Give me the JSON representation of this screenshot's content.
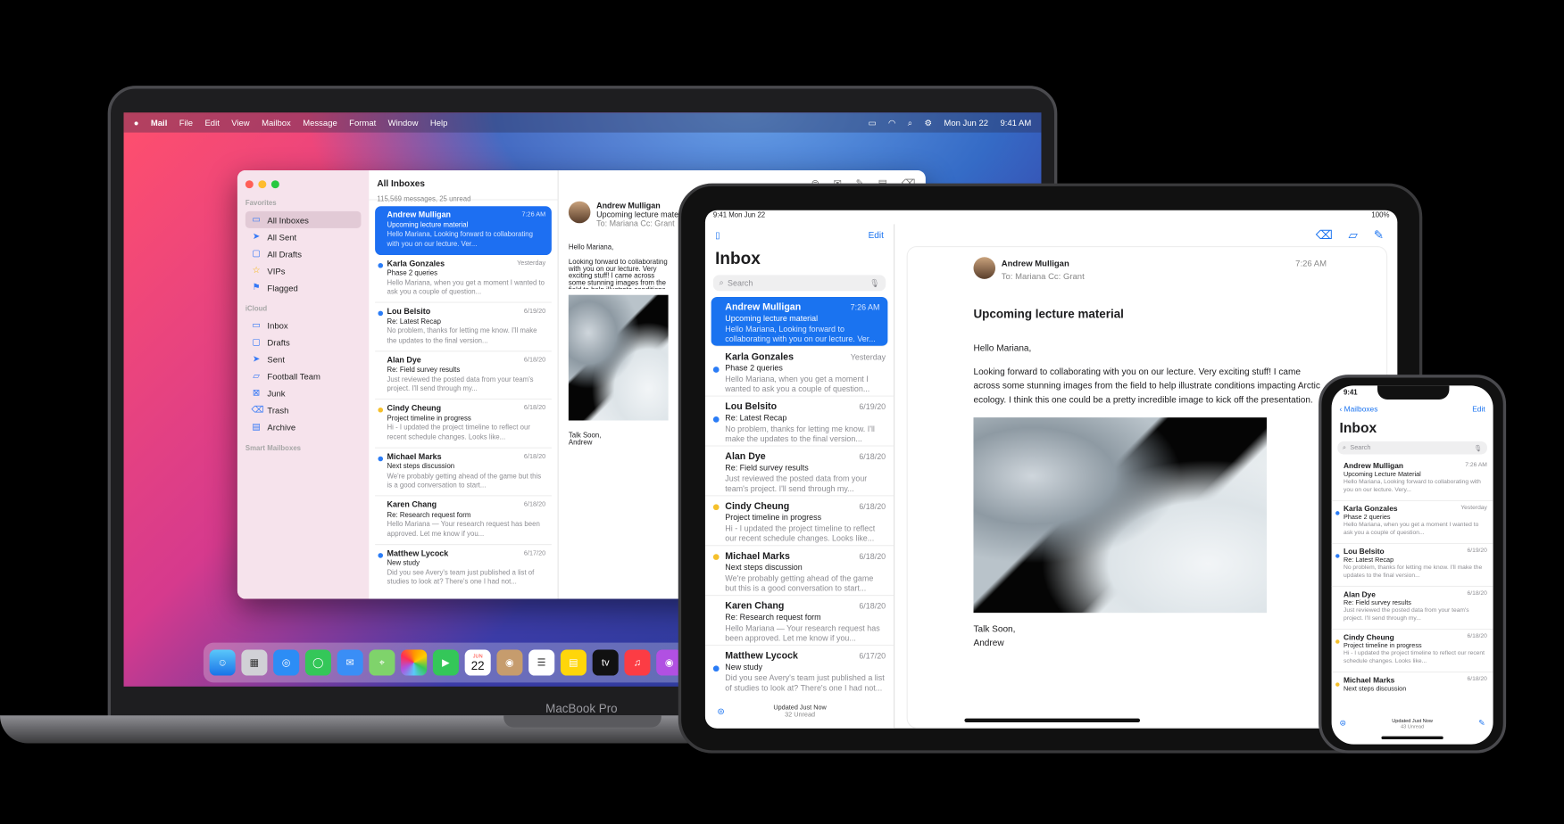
{
  "mac": {
    "menubar": {
      "apple": "",
      "items": [
        "Mail",
        "File",
        "Edit",
        "View",
        "Mailbox",
        "Message",
        "Format",
        "Window",
        "Help"
      ],
      "date": "Mon Jun 22",
      "time": "9:41 AM"
    },
    "label": "MacBook Pro",
    "sidebar": {
      "favorites_heading": "Favorites",
      "favorites": [
        "All Inboxes",
        "All Sent",
        "All Drafts",
        "VIPs",
        "Flagged"
      ],
      "icloud_heading": "iCloud",
      "icloud": [
        "Inbox",
        "Drafts",
        "Sent",
        "Football Team",
        "Junk",
        "Trash",
        "Archive"
      ],
      "smart_heading": "Smart Mailboxes"
    },
    "list": {
      "title": "All Inboxes",
      "subtitle": "115,569 messages, 25 unread",
      "messages": [
        {
          "from": "Andrew Mulligan",
          "date": "7:26 AM",
          "subject": "Upcoming lecture material",
          "preview": "Hello Mariana, Looking forward to collaborating with you on our lecture. Ver..."
        },
        {
          "from": "Karla Gonzales",
          "date": "Yesterday",
          "subject": "Phase 2 queries",
          "preview": "Hello Mariana, when you get a moment I wanted to ask you a couple of question..."
        },
        {
          "from": "Lou Belsito",
          "date": "6/19/20",
          "subject": "Re: Latest Recap",
          "preview": "No problem, thanks for letting me know. I'll make the updates to the final version..."
        },
        {
          "from": "Alan Dye",
          "date": "6/18/20",
          "subject": "Re: Field survey results",
          "preview": "Just reviewed the posted data from your team's project. I'll send through my..."
        },
        {
          "from": "Cindy Cheung",
          "date": "6/18/20",
          "subject": "Project timeline in progress",
          "preview": "Hi - I updated the project timeline to reflect our recent schedule changes. Looks like..."
        },
        {
          "from": "Michael Marks",
          "date": "6/18/20",
          "subject": "Next steps discussion",
          "preview": "We're probably getting ahead of the game but this is a good conversation to start..."
        },
        {
          "from": "Karen Chang",
          "date": "6/18/20",
          "subject": "Re: Research request form",
          "preview": "Hello Mariana — Your research request has been approved. Let me know if you..."
        },
        {
          "from": "Matthew Lycock",
          "date": "6/17/20",
          "subject": "New study",
          "preview": "Did you see Avery's team just published a list of studies to look at? There's one I had not..."
        }
      ]
    },
    "view": {
      "from": "Andrew Mulligan",
      "subject": "Upcoming lecture material",
      "to": "To:",
      "to_name": "Mariana",
      "cc": "Cc:",
      "cc_name": "Grant",
      "greeting": "Hello Mariana,",
      "body_short": "Looking forward to collaborating with you on our lecture. Very exciting stuff! I came across some stunning images from the field to help illustrate conditions impacting Arctic ecology. I think this one could be a pretty incredible image to kick off the presentation.",
      "sign1": "Talk Soon,",
      "sign2": "Andrew"
    },
    "dock_calendar_month": "JUN",
    "dock_calendar_day": "22",
    "dock_tv": "tv"
  },
  "ipad": {
    "status_time": "9:41",
    "status_date": "Mon Jun 22",
    "status_battery": "100%",
    "edit": "Edit",
    "title": "Inbox",
    "search_placeholder": "Search",
    "footer_status": "Updated Just Now",
    "footer_unread": "32 Unread",
    "view": {
      "from": "Andrew Mulligan",
      "time": "7:26 AM",
      "to": "To:",
      "to_name": "Mariana",
      "cc": "Cc:",
      "cc_name": "Grant",
      "subject": "Upcoming lecture material",
      "greeting": "Hello Mariana,",
      "body": "Looking forward to collaborating with you on our lecture. Very exciting stuff! I came across some stunning images from the field to help illustrate conditions impacting Arctic ecology. I think this one could be a pretty incredible image to kick off the presentation.",
      "sign1": "Talk Soon,",
      "sign2": "Andrew"
    }
  },
  "iphone": {
    "status_time": "9:41",
    "back": "Mailboxes",
    "edit": "Edit",
    "title": "Inbox",
    "search_placeholder": "Search",
    "footer_status": "Updated Just Now",
    "footer_unread": "43 Unread",
    "messages": [
      {
        "from": "Andrew Mulligan",
        "date": "7:26 AM",
        "subject": "Upcoming Lecture Material",
        "preview": "Hello Mariana, Looking forward to collaborating with you on our lecture. Very..."
      },
      {
        "from": "Karla Gonzales",
        "date": "Yesterday",
        "subject": "Phase 2 queries",
        "preview": "Hello Mariana, when you get a moment I wanted to ask you a couple of question..."
      },
      {
        "from": "Lou Belsito",
        "date": "6/19/20",
        "subject": "Re: Latest Recap",
        "preview": "No problem, thanks for letting me know. I'll make the updates to the final version..."
      },
      {
        "from": "Alan Dye",
        "date": "6/18/20",
        "subject": "Re: Field survey results",
        "preview": "Just reviewed the posted data from your team's project. I'll send through my..."
      },
      {
        "from": "Cindy Cheung",
        "date": "6/18/20",
        "subject": "Project timeline in progress",
        "preview": "Hi - I updated the project timeline to reflect our recent schedule changes. Looks like..."
      },
      {
        "from": "Michael Marks",
        "date": "6/18/20",
        "subject": "Next steps discussion",
        "preview": ""
      }
    ]
  },
  "colors": {
    "accent": "#1a73f0",
    "unread_dot": "#2a7cf6",
    "flag": "#f5c02b",
    "sidebar_pink": "#f6e3ec"
  }
}
